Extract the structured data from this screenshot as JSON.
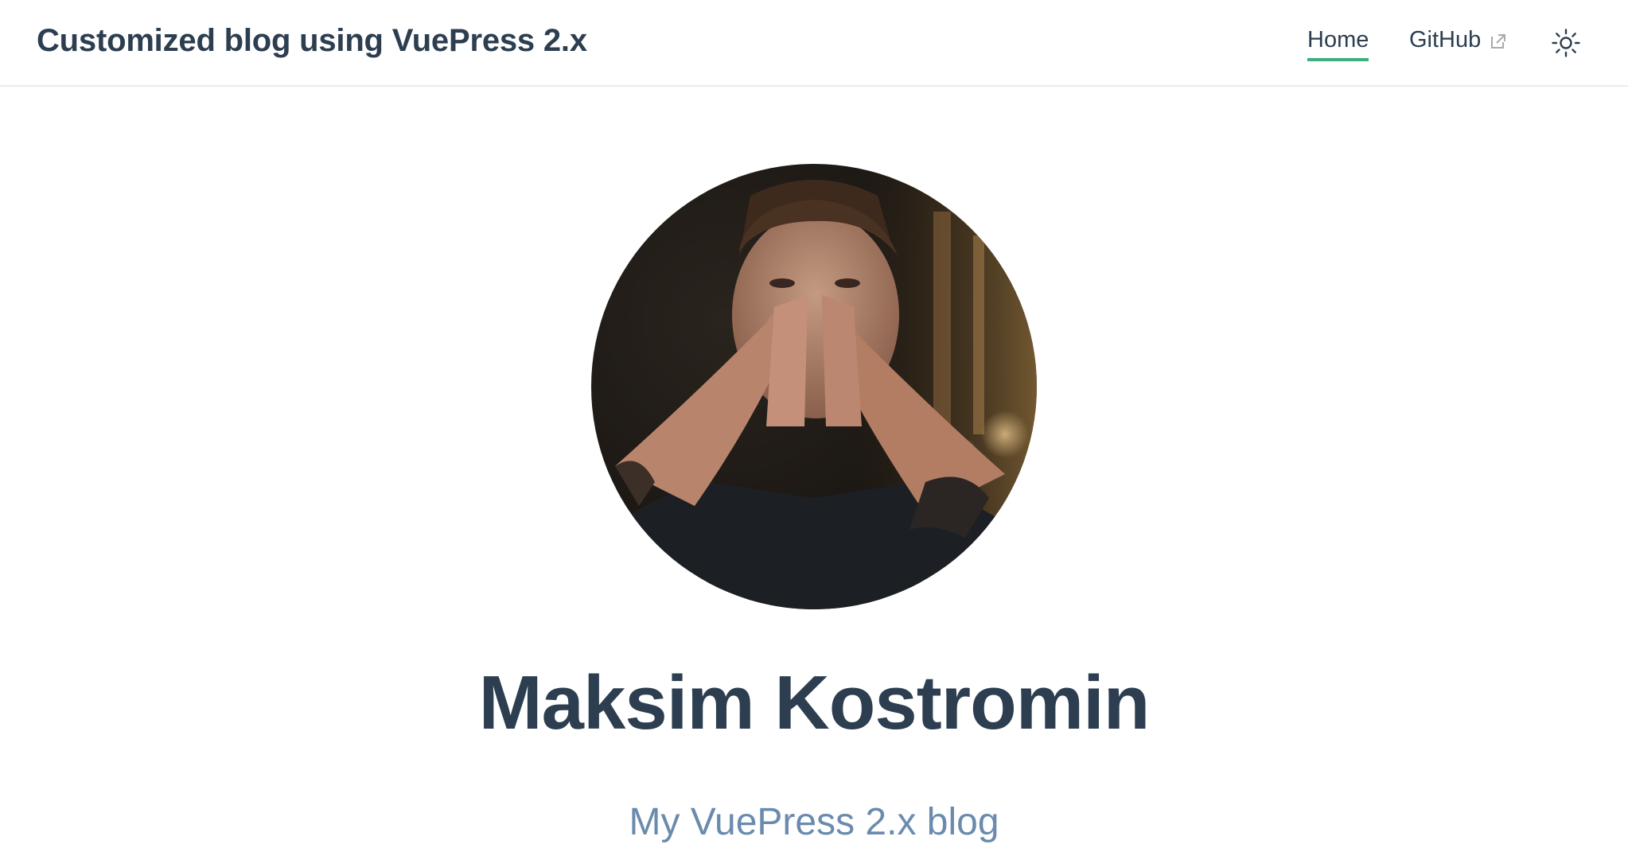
{
  "navbar": {
    "site_title": "Customized blog using VuePress 2.x",
    "links": [
      {
        "label": "Home",
        "active": true
      },
      {
        "label": "GitHub",
        "external": true
      }
    ],
    "theme_toggle_icon": "sun-icon",
    "external_icon": "external-link-icon"
  },
  "hero": {
    "avatar_icon": "avatar",
    "name": "Maksim Kostromin",
    "tagline": "My VuePress 2.x blog"
  },
  "colors": {
    "accent": "#3eaf7c",
    "text": "#2c3e50",
    "tagline": "#6a8bad",
    "border": "#eaecef"
  }
}
